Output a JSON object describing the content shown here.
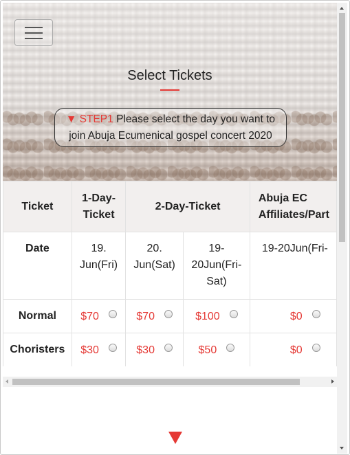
{
  "header": {
    "title": "Select Tickets",
    "step_label": "▼ STEP1",
    "step_text_line1": "Please select the day you want to",
    "step_text_line2": "join Abuja Ecumenical gospel concert 2020"
  },
  "table": {
    "headers": {
      "ticket": "Ticket",
      "one_day": "1-Day-Ticket",
      "two_day": "2-Day-Ticket",
      "affiliates": "Abuja EC Affiliates/Part"
    },
    "date_row": {
      "label": "Date",
      "c1": "19. Jun(Fri)",
      "c2": "20. Jun(Sat)",
      "c3": "19-20Jun(Fri-Sat)",
      "c4": "19-20Jun(Fri-"
    },
    "normal_row": {
      "label": "Normal",
      "c1": "$70",
      "c2": "$70",
      "c3": "$100",
      "c4": "$0"
    },
    "choristers_row": {
      "label": "Choristers",
      "c1": "$30",
      "c2": "$30",
      "c3": "$50",
      "c4": "$0"
    }
  },
  "colors": {
    "accent": "#e53935",
    "header_bg": "#f2efee"
  },
  "icons": {
    "menu": "hamburger-menu-icon",
    "next": "down-triangle-icon"
  }
}
